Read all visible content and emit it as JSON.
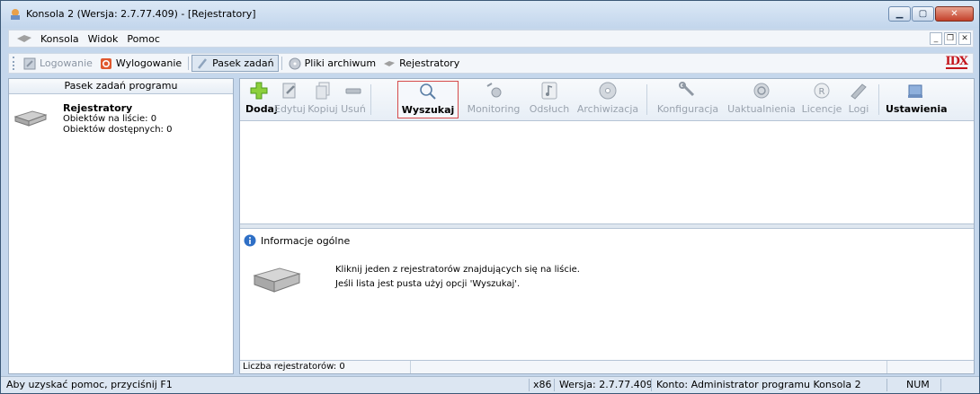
{
  "window": {
    "title": "Konsola 2 (Wersja: 2.7.77.409) - [Rejestratory]"
  },
  "menubar": {
    "items": [
      "Konsola",
      "Widok",
      "Pomoc"
    ]
  },
  "toolbar": {
    "logowanie_label": "Logowanie",
    "wylogowanie_label": "Wylogowanie",
    "pasek_label": "Pasek zadań",
    "pliki_label": "Pliki archiwum",
    "rejestratory_label": "Rejestratory",
    "logo_text": "IDX"
  },
  "left_panel": {
    "header": "Pasek zadań programu",
    "entry": {
      "title": "Rejestratory",
      "line1": "Obiektów na liście: 0",
      "line2": "Obiektów dostępnych: 0"
    }
  },
  "big_toolbar": {
    "dodaj": "Dodaj",
    "edytuj": "Edytuj",
    "kopiuj": "Kopiuj",
    "usun": "Usuń",
    "wyszukaj": "Wyszukaj",
    "monitoring": "Monitoring",
    "odsluch": "Odsłuch",
    "archiwizacja": "Archiwizacja",
    "konfiguracja": "Konfiguracja",
    "uaktualnienia": "Uaktualnienia",
    "licencje": "Licencje",
    "logi": "Logi",
    "ustawienia": "Ustawienia"
  },
  "info": {
    "header": "Informacje ogólne",
    "line1": "Kliknij jeden z rejestratorów znajdujących się na liście.",
    "line2": "Jeśli lista jest pusta użyj opcji 'Wyszukaj'."
  },
  "panel_status": {
    "count": "Liczba rejestratorów: 0"
  },
  "statusbar": {
    "help": "Aby uzyskać pomoc, przyciśnij F1",
    "arch": "x86",
    "version": "Wersja: 2.7.77.409",
    "account": "Konto: Administrator programu Konsola 2",
    "num": "NUM"
  },
  "colors": {
    "accent_red": "#c4161c",
    "selection_border": "#d54a4a",
    "frame_blue": "#c5d7ec"
  }
}
